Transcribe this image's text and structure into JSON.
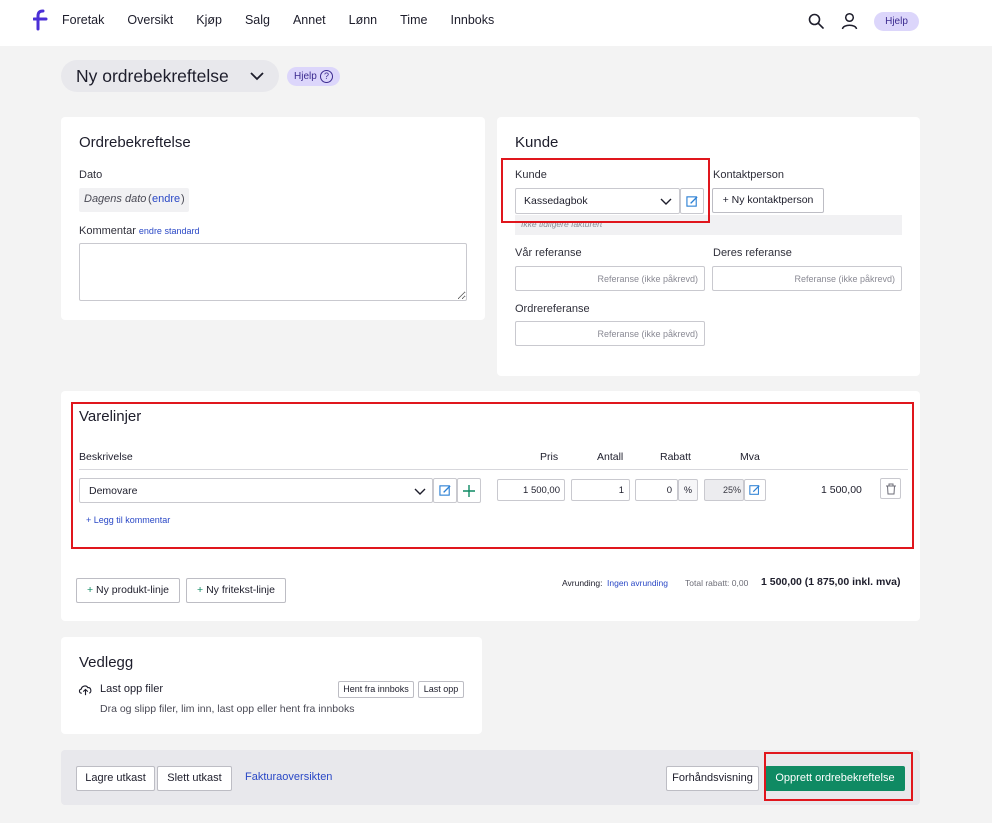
{
  "nav": {
    "items": [
      "Foretak",
      "Oversikt",
      "Kjøp",
      "Salg",
      "Annet",
      "Lønn",
      "Time",
      "Innboks"
    ],
    "help_label": "Hjelp"
  },
  "page": {
    "title": "Ny ordrebekreftelse",
    "help_label": "Hjelp",
    "help_icon": "?"
  },
  "order": {
    "title": "Ordrebekreftelse",
    "date_label": "Dato",
    "date_value": "Dagens dato",
    "date_edit_link": "endre",
    "date_open": "(",
    "date_close": ")",
    "comment_label": "Kommentar",
    "comment_link": "endre standard",
    "comment_value": ""
  },
  "customer": {
    "title": "Kunde",
    "customer_label": "Kunde",
    "customer_value": "Kassedagbok",
    "customer_note": "Ikke tidligere fakturert",
    "contact_label": "Kontaktperson",
    "new_contact_button": "+ Ny kontaktperson",
    "our_ref_label": "Vår referanse",
    "our_ref_placeholder": "Referanse (ikke påkrevd)",
    "their_ref_label": "Deres referanse",
    "their_ref_placeholder": "Referanse (ikke påkrevd)",
    "order_ref_label": "Ordrereferanse",
    "order_ref_placeholder": "Referanse (ikke påkrevd)"
  },
  "lines": {
    "title": "Varelinjer",
    "headers": {
      "description": "Beskrivelse",
      "price": "Pris",
      "qty": "Antall",
      "discount": "Rabatt",
      "vat": "Mva"
    },
    "rows": [
      {
        "product": "Demovare",
        "price": "1 500,00",
        "qty": "1",
        "discount": "0",
        "discount_unit": "%",
        "vat": "25%",
        "total": "1 500,00"
      }
    ],
    "add_comment_link": "+ Legg til kommentar",
    "new_product_line": "Ny produkt-linje",
    "new_freetext_line": "Ny fritekst-linje",
    "plus": "+",
    "rounding_label": "Avrunding:",
    "rounding_value": "Ingen avrunding",
    "total_discount": "Total rabatt: 0,00",
    "grand_total": "1 500,00 (1 875,00 inkl. mva)"
  },
  "attachments": {
    "title": "Vedlegg",
    "upload_label": "Last opp filer",
    "upload_hint": "Dra og slipp filer, lim inn, last opp eller hent fra innboks",
    "fetch_inbox_button": "Hent fra innboks",
    "upload_button": "Last opp"
  },
  "footer": {
    "save_draft": "Lagre utkast",
    "delete_draft": "Slett utkast",
    "invoice_overview": "Fakturaoversikten",
    "preview": "Forhåndsvisning",
    "create": "Opprett ordrebekreftelse"
  },
  "colors": {
    "brand": "#4b2fd6",
    "primary_button": "#0f8a63",
    "link": "#2a48c6",
    "highlight_box": "#e0161d"
  }
}
